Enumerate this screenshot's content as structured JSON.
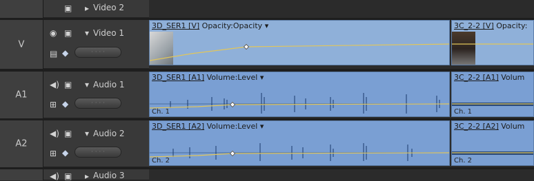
{
  "tracks": {
    "video2": {
      "name": "Video 2",
      "id": ""
    },
    "video1": {
      "id": "V",
      "name": "Video 1"
    },
    "audio1": {
      "id": "A1",
      "name": "Audio 1"
    },
    "audio2": {
      "id": "A2",
      "name": "Audio 2"
    },
    "audio3": {
      "name": "Audio 3"
    }
  },
  "clips": {
    "v1_a": {
      "name": "3D_SER1 [V]",
      "fx": "Opacity:Opacity",
      "dropdown": "▾"
    },
    "v1_b": {
      "name": "3C_2-2 [V]",
      "fx": "Opacity:"
    },
    "a1_a": {
      "name": "3D_SER1 [A1]",
      "fx": "Volume:Level",
      "dropdown": "▾",
      "channel": "Ch. 1"
    },
    "a1_b": {
      "name": "3C_2-2 [A1]",
      "fx": "Volum",
      "channel": "Ch. 1"
    },
    "a2_a": {
      "name": "3D_SER1 [A2]",
      "fx": "Volume:Level",
      "dropdown": "▾",
      "channel": "Ch. 2"
    },
    "a2_b": {
      "name": "3C_2-2 [A2]",
      "fx": "Volum",
      "channel": "Ch. 2"
    }
  },
  "icons": {
    "eye": "eye-icon",
    "speaker": "speaker-icon",
    "film": "filmstrip-icon",
    "waveform": "waveform-icon",
    "keyframe": "keyframe-icon"
  },
  "colors": {
    "clip": "#8fb0d9",
    "audio_clip": "#7a9fd3",
    "rubberband": "#e2c65a",
    "waveform": "#1b3a6b"
  }
}
